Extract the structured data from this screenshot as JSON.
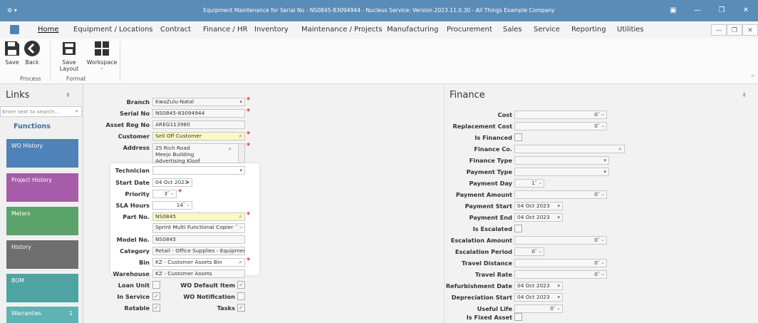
{
  "window": {
    "title": "Equipment Maintenance for Serial No : NS0845-83094944 - Nucleus Service: Version 2023.11.0.30 - All Things Example Company"
  },
  "menu": {
    "tabs": [
      "Home",
      "Equipment / Locations",
      "Contract",
      "Finance / HR",
      "Inventory",
      "Maintenance / Projects",
      "Manufacturing",
      "Procurement",
      "Sales",
      "Service",
      "Reporting",
      "Utilities"
    ],
    "active": "Home"
  },
  "ribbon": {
    "process": {
      "label": "Process",
      "buttons": [
        "Save",
        "Back"
      ]
    },
    "format": {
      "label": "Format",
      "buttons": [
        "Save Layout",
        "Workspace"
      ]
    }
  },
  "links": {
    "title": "Links",
    "search_placeholder": "Enter text to search...",
    "functions_label": "Functions",
    "tiles": [
      {
        "label": "WO History",
        "color": "#4f82b8"
      },
      {
        "label": "Project History",
        "color": "#a65ca8"
      },
      {
        "label": "Meters",
        "color": "#5ba36a"
      },
      {
        "label": "History",
        "color": "#6e6e6e"
      },
      {
        "label": "BOM",
        "color": "#4ea3a3"
      },
      {
        "label": "Warranties",
        "color": "#5fb3b3",
        "count": "1"
      }
    ]
  },
  "details": {
    "branch": {
      "label": "Branch",
      "value": "KwaZulu-Natal"
    },
    "serial_no": {
      "label": "Serial No",
      "value": "NS0845-83094944"
    },
    "asset_reg_no": {
      "label": "Asset Reg No",
      "value": "AREG113980"
    },
    "customer": {
      "label": "Customer",
      "value": "Sell Off Customer"
    },
    "address": {
      "label": "Address",
      "lines": [
        "25 Rich Road",
        "Meejo Building",
        "Advertising Kloof"
      ]
    },
    "technician": {
      "label": "Technician",
      "value": ""
    },
    "start_date": {
      "label": "Start Date",
      "value": "04 Oct 2023"
    },
    "priority": {
      "label": "Priority",
      "value": "3"
    },
    "sla_hours": {
      "label": "SLA Hours",
      "value": "14"
    },
    "part_no": {
      "label": "Part No.",
      "value": "NS0845",
      "description": "Sprint Multi Functional Copier"
    },
    "model_no": {
      "label": "Model No.",
      "value": "NS0845"
    },
    "category": {
      "label": "Category",
      "value": "Retail - Office Supplies - Equipment"
    },
    "bin": {
      "label": "Bin",
      "value": "KZ - Customer Assets Bin"
    },
    "warehouse": {
      "label": "Warehouse",
      "value": "KZ - Customer Assets"
    },
    "loan_unit": {
      "label": "Loan Unit",
      "checked": false
    },
    "in_service": {
      "label": "In Service",
      "checked": true
    },
    "rotable": {
      "label": "Rotable",
      "checked": true
    },
    "wo_default_item": {
      "label": "WO Default Item",
      "checked": true
    },
    "wo_notification": {
      "label": "WO Notification",
      "checked": false
    },
    "tasks": {
      "label": "Tasks",
      "checked": true
    }
  },
  "finance": {
    "title": "Finance",
    "cost": {
      "label": "Cost",
      "value": "0"
    },
    "replacement_cost": {
      "label": "Replacement Cost",
      "value": "0"
    },
    "is_financed": {
      "label": "Is Financed",
      "checked": false
    },
    "finance_co": {
      "label": "Finance Co.",
      "value": ""
    },
    "finance_type": {
      "label": "Finance Type",
      "value": ""
    },
    "payment_type": {
      "label": "Payment Type",
      "value": ""
    },
    "payment_day": {
      "label": "Payment Day",
      "value": "1"
    },
    "payment_amount": {
      "label": "Payment Amount",
      "value": "0"
    },
    "payment_start": {
      "label": "Payment Start",
      "value": "04 Oct 2023"
    },
    "payment_end": {
      "label": "Payment End",
      "value": "04 Oct 2023"
    },
    "is_escalated": {
      "label": "Is Escalated",
      "checked": false
    },
    "escalation_amount": {
      "label": "Escalation Amount",
      "value": "0"
    },
    "escalation_period": {
      "label": "Escalation Period",
      "value": "0"
    },
    "travel_distance": {
      "label": "Travel Distance",
      "value": "0"
    },
    "travel_rate": {
      "label": "Travel Rate",
      "value": "0"
    },
    "refurbishment_date": {
      "label": "Refurbishment Date",
      "value": "04 Oct 2023"
    },
    "depreciation_start": {
      "label": "Depreciation Start",
      "value": "04 Oct 2023"
    },
    "useful_life": {
      "label": "Useful Life",
      "value": "0"
    },
    "is_fixed_asset": {
      "label": "Is Fixed Asset",
      "checked": false
    }
  },
  "colors": {
    "titlebar": "#5a8cb8",
    "required": "#e03030",
    "lookup_highlight": "#fbf8c6"
  }
}
